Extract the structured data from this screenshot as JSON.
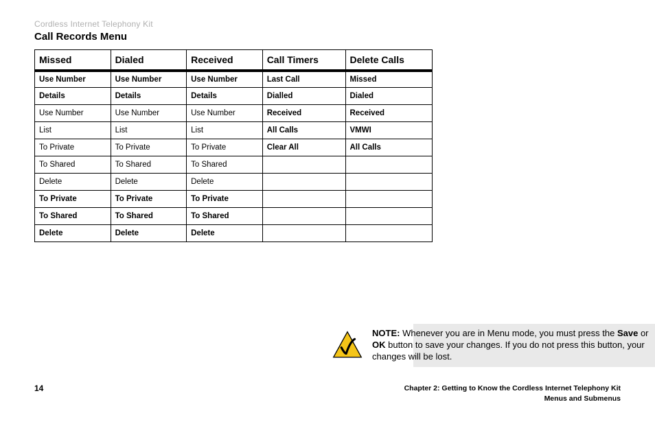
{
  "top_label": "Cordless Internet Telephony Kit",
  "section_title": "Call Records Menu",
  "table": {
    "headers": [
      "Missed",
      "Dialed",
      "Received",
      "Call Timers",
      "Delete Calls"
    ],
    "rows": [
      [
        {
          "t": "Use Number",
          "b": true
        },
        {
          "t": "Use Number",
          "b": true
        },
        {
          "t": "Use Number",
          "b": true
        },
        {
          "t": "Last Call",
          "b": true
        },
        {
          "t": "Missed",
          "b": true
        }
      ],
      [
        {
          "t": "Details",
          "b": true
        },
        {
          "t": "Details",
          "b": true
        },
        {
          "t": "Details",
          "b": true
        },
        {
          "t": "Dialled",
          "b": true
        },
        {
          "t": "Dialed",
          "b": true
        }
      ],
      [
        {
          "t": "Use Number",
          "b": false
        },
        {
          "t": "Use Number",
          "b": false
        },
        {
          "t": "Use Number",
          "b": false
        },
        {
          "t": "Received",
          "b": true
        },
        {
          "t": "Received",
          "b": true
        }
      ],
      [
        {
          "t": "List",
          "b": false
        },
        {
          "t": "List",
          "b": false
        },
        {
          "t": "List",
          "b": false
        },
        {
          "t": "All Calls",
          "b": true
        },
        {
          "t": "VMWI",
          "b": true
        }
      ],
      [
        {
          "t": "To Private",
          "b": false
        },
        {
          "t": "To Private",
          "b": false
        },
        {
          "t": "To Private",
          "b": false
        },
        {
          "t": "Clear All",
          "b": true
        },
        {
          "t": "All Calls",
          "b": true
        }
      ],
      [
        {
          "t": "To Shared",
          "b": false
        },
        {
          "t": "To Shared",
          "b": false
        },
        {
          "t": "To Shared",
          "b": false
        },
        {
          "t": "",
          "b": false
        },
        {
          "t": "",
          "b": false
        }
      ],
      [
        {
          "t": "Delete",
          "b": false
        },
        {
          "t": "Delete",
          "b": false
        },
        {
          "t": "Delete",
          "b": false
        },
        {
          "t": "",
          "b": false
        },
        {
          "t": "",
          "b": false
        }
      ],
      [
        {
          "t": "To Private",
          "b": true
        },
        {
          "t": "To Private",
          "b": true
        },
        {
          "t": "To Private",
          "b": true
        },
        {
          "t": "",
          "b": false
        },
        {
          "t": "",
          "b": false
        }
      ],
      [
        {
          "t": "To Shared",
          "b": true
        },
        {
          "t": "To Shared",
          "b": true
        },
        {
          "t": "To Shared",
          "b": true
        },
        {
          "t": "",
          "b": false
        },
        {
          "t": "",
          "b": false
        }
      ],
      [
        {
          "t": "Delete",
          "b": true
        },
        {
          "t": "Delete",
          "b": true
        },
        {
          "t": "Delete",
          "b": true
        },
        {
          "t": "",
          "b": false
        },
        {
          "t": "",
          "b": false
        }
      ]
    ]
  },
  "note": {
    "prefix": "NOTE:",
    "body_1": " Whenever you are in Menu mode, you must press the ",
    "bold_1": "Save",
    "body_2": " or ",
    "bold_2": "OK",
    "body_3": " button to save your changes. If you do not press this button, your changes will be lost."
  },
  "footer": {
    "page": "14",
    "chapter": "Chapter 2: Getting to Know the Cordless Internet Telephony Kit",
    "sub": "Menus and Submenus"
  }
}
